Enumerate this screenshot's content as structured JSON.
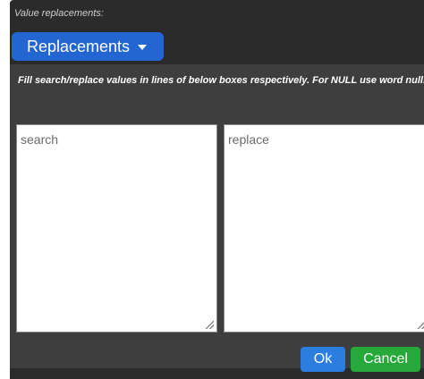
{
  "dialog": {
    "section_label": "Value replacements:",
    "replacements_button": "Replacements",
    "hint": "Fill search/replace values in lines of below boxes respectively. For NULL use word null.",
    "search_placeholder": "search",
    "replace_placeholder": "replace",
    "ok_label": "Ok",
    "cancel_label": "Cancel",
    "colors": {
      "primary": "#2466d1",
      "ok": "#2b7de0",
      "cancel": "#27a83a",
      "panel_bg": "#2b2b2b",
      "inner_bg": "#3e3e3e"
    }
  },
  "icons": {
    "caret": "caret-down-icon",
    "resize": "resize-grip-icon"
  }
}
